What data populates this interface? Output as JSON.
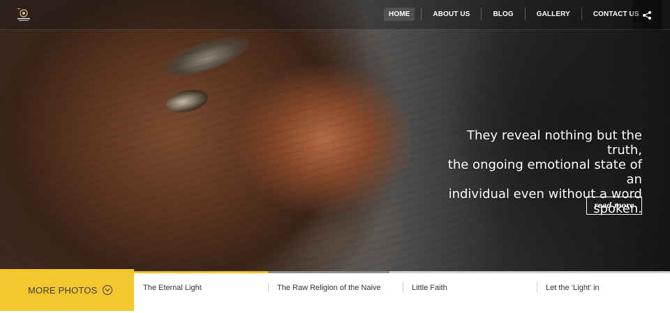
{
  "header": {
    "logo_name": "photography-studio-logo",
    "nav": [
      {
        "label": "HOME",
        "active": true
      },
      {
        "label": "ABOUT US",
        "active": false
      },
      {
        "label": "BLOG",
        "active": false
      },
      {
        "label": "GALLERY",
        "active": false
      },
      {
        "label": "CONTACT US",
        "active": false
      }
    ],
    "share_icon": "share-icon"
  },
  "hero": {
    "quote_lines": [
      "They reveal nothing but the truth,",
      "the ongoing emotional state of an",
      "individual even without a word",
      "spoken."
    ],
    "read_more_label": "read more"
  },
  "slider": {
    "more_photos_label": "MORE PHOTOS",
    "more_photos_icon": "chevron-down-circle-icon",
    "progress": 0.25,
    "items": [
      {
        "title": "The Eternal Light"
      },
      {
        "title": "The Raw Religion of the Naive"
      },
      {
        "title": "Little Faith"
      },
      {
        "title": "Let the ‘Light’ in"
      }
    ]
  },
  "colors": {
    "accent_yellow": "#f5c72f",
    "text_dark": "#333333",
    "white": "#ffffff"
  }
}
